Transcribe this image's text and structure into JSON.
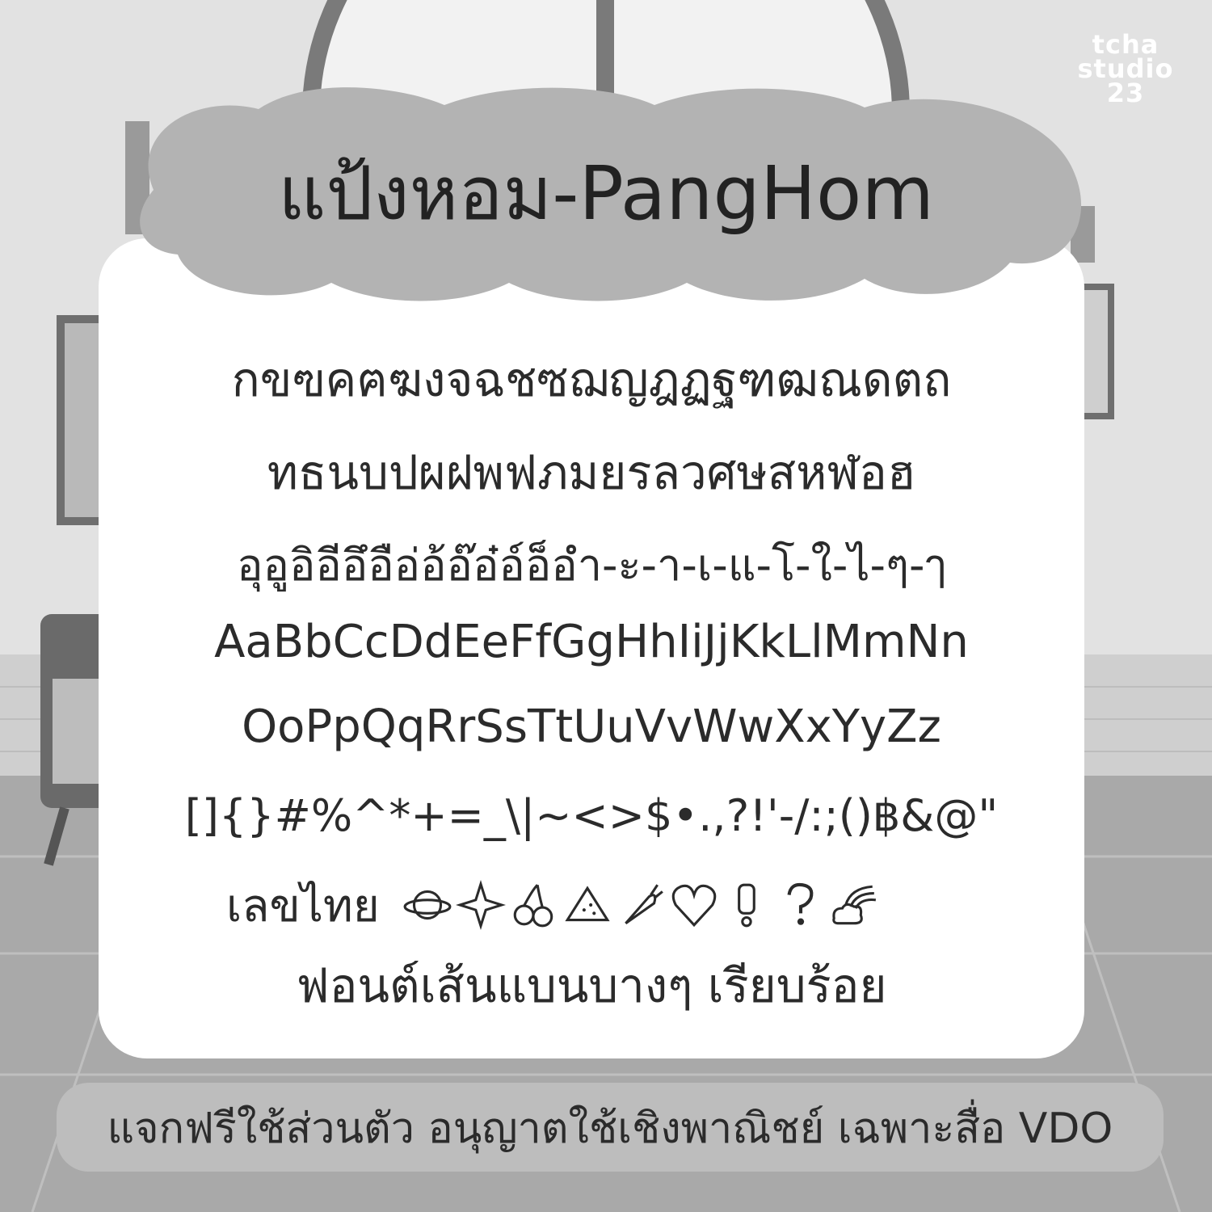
{
  "title": "แป้งหอม-PangHom",
  "logo": {
    "line1": "tcha",
    "line2": "studio",
    "line3": "23"
  },
  "sample_lines": [
    "กขฃคฅฆงจฉชซฌญฎฏฐฑฒณดตถ",
    "ทธนบปผฝพฟภมยรลวศษสหฬอฮ",
    "อุอูอิอีอึอือ่อ้อ๊อ๋อ์อ็อำ-ะ-า-เ-แ-โ-ใ-ไ-ๆ-ๅ",
    "AaBbCcDdEeFfGgHhIiJjKkLlMmNn",
    "OoPpQqRrSsTtUuVvWwXxYyZz",
    "[]{}#%^*+=_\\|~<>$•.,?!'-/:;()฿&@\""
  ],
  "icons_label": "เลขไทย",
  "icons": [
    "planet-icon",
    "sparkle-icon",
    "cherry-icon",
    "watermelon-icon",
    "carrot-icon",
    "heart-icon",
    "exclamation-icon",
    "question-icon",
    "rainbow-cloud-icon"
  ],
  "description": "ฟอนต์เส้นแบนบางๆ เรียบร้อย",
  "footer": "แจกฟรีใช้ส่วนตัว อนุญาตใช้เชิงพาณิชย์ เฉพาะสื่อ VDO",
  "colors": {
    "card": "#ffffff",
    "cloud": "#b3b3b3",
    "footer": "#bdbdbd",
    "text": "#2b2b2b"
  }
}
